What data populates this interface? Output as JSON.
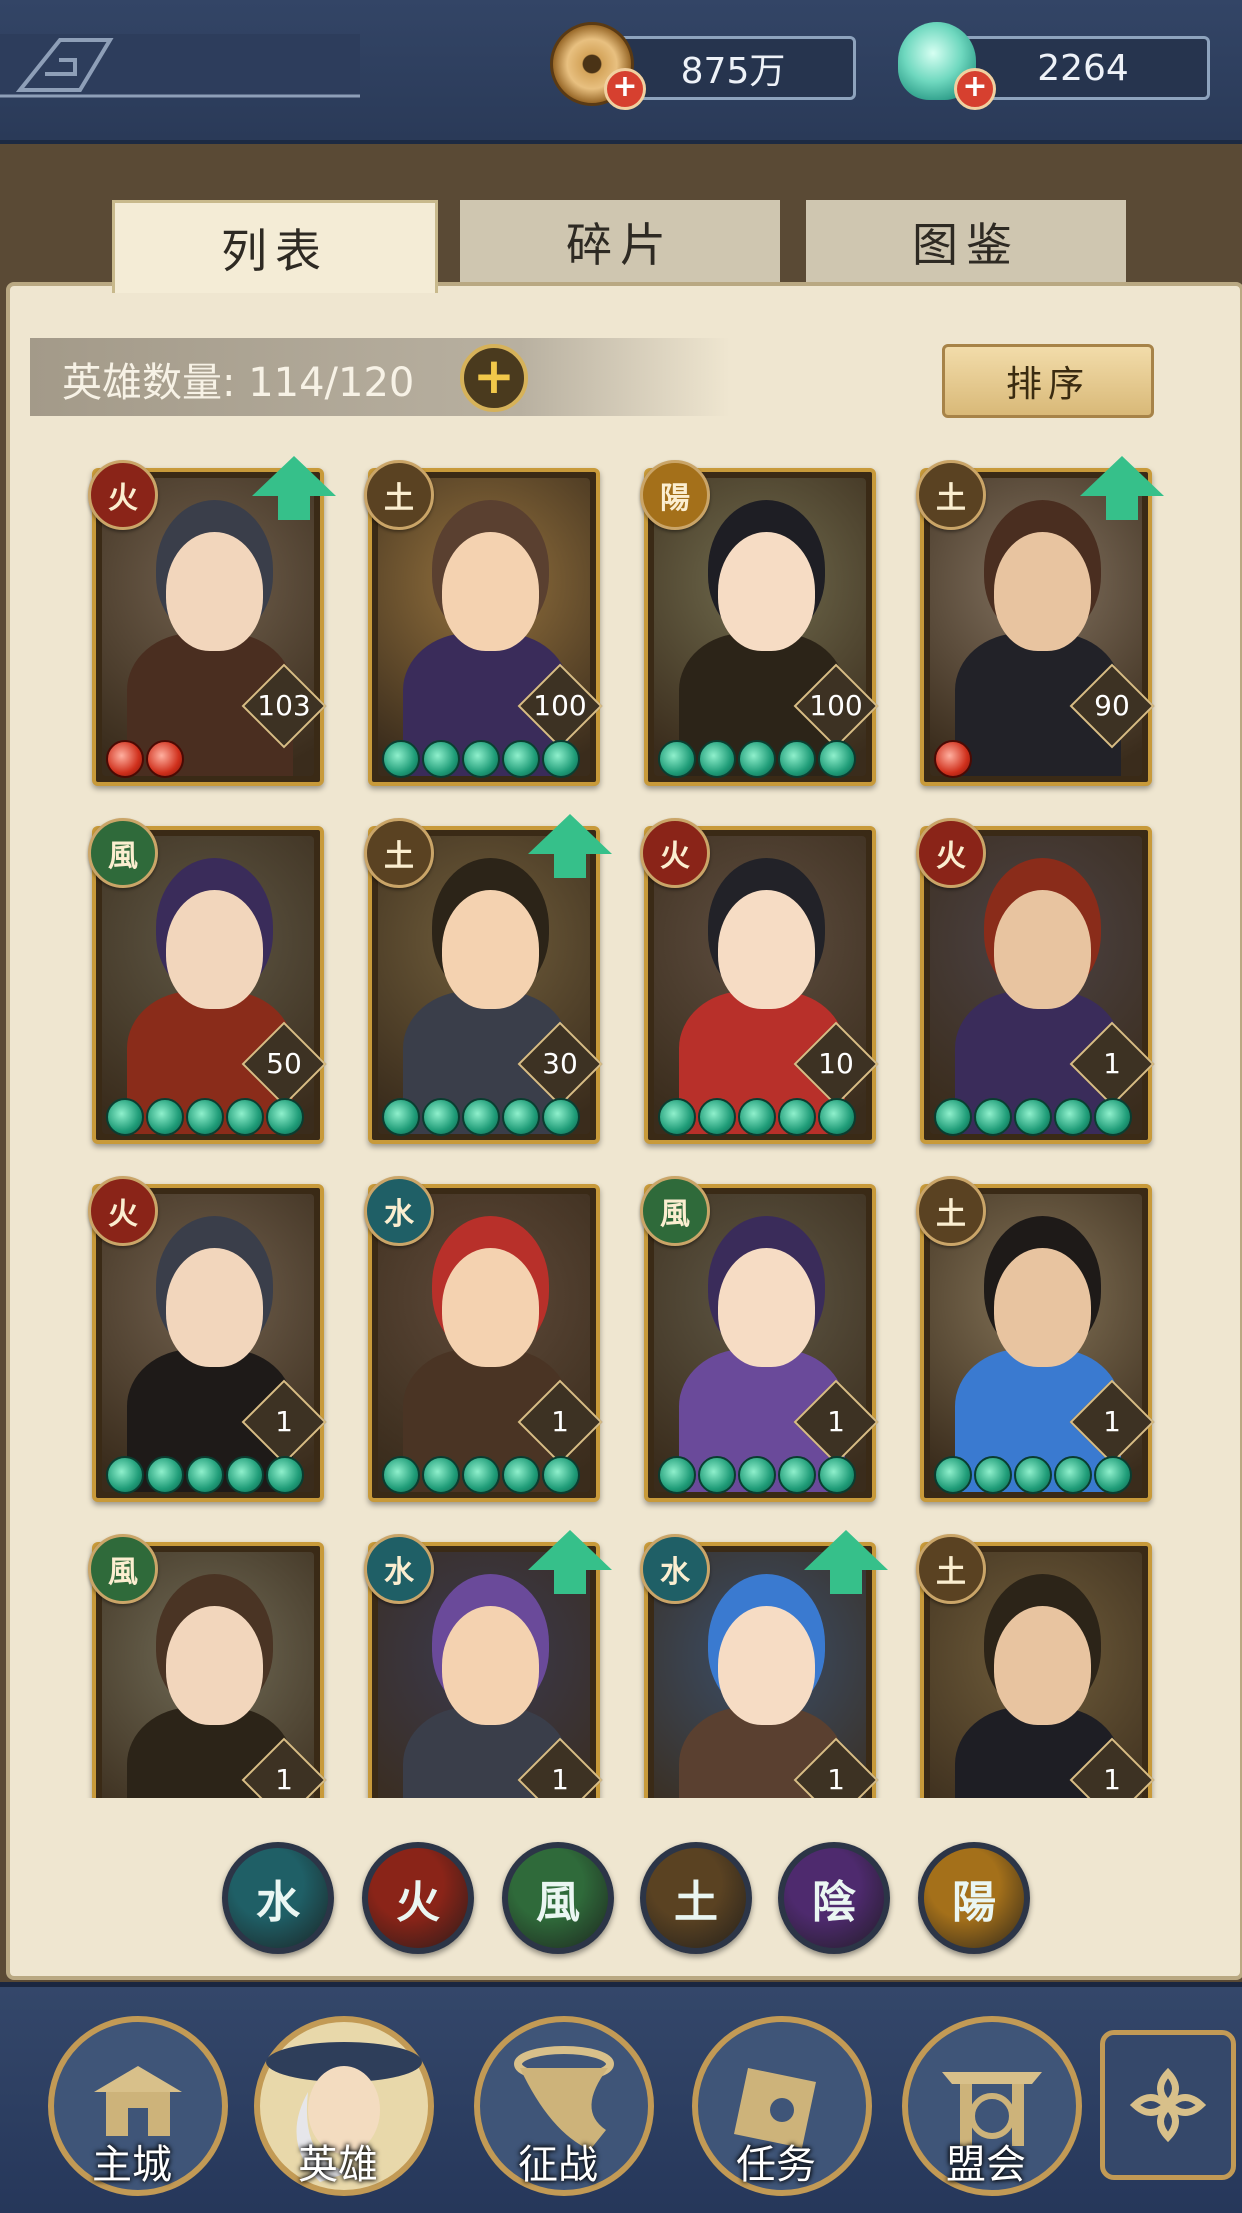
{
  "topbar": {
    "coins": "875万",
    "shells": "2264"
  },
  "tabs": [
    {
      "label": "列表",
      "active": true
    },
    {
      "label": "碎片",
      "active": false
    },
    {
      "label": "图鉴",
      "active": false
    }
  ],
  "hero_count": {
    "label": "英雄数量: 114/120",
    "add_button": "+"
  },
  "sort_button": "排序",
  "heroes": [
    {
      "element": "火",
      "level": "103",
      "stars": 2,
      "star_color": "red",
      "upgrade": true,
      "name_hint": "masked-warrior"
    },
    {
      "element": "土",
      "level": "100",
      "stars": 5,
      "star_color": "green",
      "upgrade": false,
      "name_hint": "spiky-youth"
    },
    {
      "element": "陽",
      "level": "100",
      "stars": 5,
      "star_color": "green",
      "upgrade": false,
      "name_hint": "mirror-lady"
    },
    {
      "element": "土",
      "level": "90",
      "stars": 1,
      "star_color": "red",
      "upgrade": true,
      "name_hint": "crowned-general"
    },
    {
      "element": "風",
      "level": "50",
      "stars": 5,
      "star_color": "green",
      "upgrade": false,
      "name_hint": "purple-hair-lady"
    },
    {
      "element": "土",
      "level": "30",
      "stars": 5,
      "star_color": "green",
      "upgrade": true,
      "name_hint": "pipa-player"
    },
    {
      "element": "火",
      "level": "10",
      "stars": 5,
      "star_color": "green",
      "upgrade": false,
      "name_hint": "straw-hat-assassin"
    },
    {
      "element": "火",
      "level": "1",
      "stars": 5,
      "star_color": "green",
      "upgrade": false,
      "name_hint": "red-hair-warrior"
    },
    {
      "element": "火",
      "level": "1",
      "stars": 5,
      "star_color": "green",
      "upgrade": false,
      "name_hint": "masked-warrior"
    },
    {
      "element": "水",
      "level": "1",
      "stars": 5,
      "star_color": "green",
      "upgrade": false,
      "name_hint": "red-hair-dancer"
    },
    {
      "element": "風",
      "level": "1",
      "stars": 5,
      "star_color": "green",
      "upgrade": false,
      "name_hint": "purple-hair-lady"
    },
    {
      "element": "土",
      "level": "1",
      "stars": 5,
      "star_color": "green",
      "upgrade": false,
      "name_hint": "fox-lady"
    },
    {
      "element": "風",
      "level": "1",
      "stars": 0,
      "star_color": "green",
      "upgrade": false,
      "name_hint": "flower-lady"
    },
    {
      "element": "水",
      "level": "1",
      "stars": 0,
      "star_color": "green",
      "upgrade": true,
      "name_hint": "violet-hair-lady"
    },
    {
      "element": "水",
      "level": "1",
      "stars": 0,
      "star_color": "green",
      "upgrade": true,
      "name_hint": "blue-hair-lady"
    },
    {
      "element": "土",
      "level": "1",
      "stars": 0,
      "star_color": "green",
      "upgrade": false,
      "name_hint": "pipa-player"
    }
  ],
  "filters": [
    {
      "label": "水",
      "color": "#1f5f66"
    },
    {
      "label": "火",
      "color": "#8a2418"
    },
    {
      "label": "風",
      "color": "#2f6a3a"
    },
    {
      "label": "土",
      "color": "#5a4222"
    },
    {
      "label": "陰",
      "color": "#4e2a6e"
    },
    {
      "label": "陽",
      "color": "#a4701a"
    }
  ],
  "element_colors": {
    "火": "#8a2418",
    "土": "#5a4222",
    "陽": "#a4701a",
    "風": "#2f6a3a",
    "水": "#1f5f66",
    "陰": "#4e2a6e"
  },
  "nav": [
    {
      "label": "主城",
      "icon": "palace-icon"
    },
    {
      "label": "英雄",
      "icon": "hero-portrait-icon"
    },
    {
      "label": "征战",
      "icon": "war-horn-icon"
    },
    {
      "label": "任务",
      "icon": "scroll-bell-icon"
    },
    {
      "label": "盟会",
      "icon": "gate-icon"
    }
  ],
  "menu_icon": "flower-menu-icon"
}
